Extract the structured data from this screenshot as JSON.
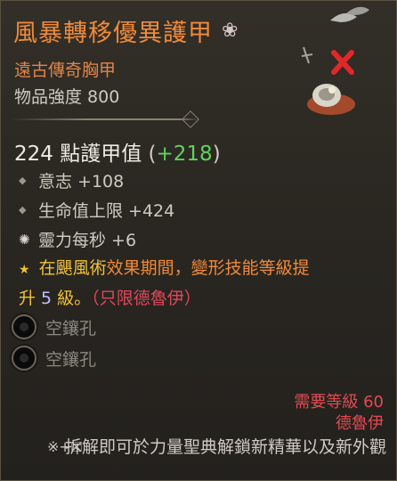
{
  "item": {
    "name": "風暴轉移優異護甲",
    "type": "遠古傳奇胸甲",
    "item_power": "物品強度 800"
  },
  "armor": {
    "base": "224 點護甲值",
    "paren_open": "(",
    "bonus": "+218",
    "paren_close": ")"
  },
  "stats": [
    {
      "label": "意志 +108"
    },
    {
      "label": "生命值上限 +424"
    },
    {
      "label": "靈力每秒 +6"
    }
  ],
  "effect": {
    "part1": "在颶風術",
    "part2": "效果期間，變形",
    "part3": "技能等級提",
    "part4": "升 ",
    "level": "5",
    "part5": " 級。",
    "restriction": "（只限德魯伊）"
  },
  "sockets": [
    {
      "label": "空鑲孔"
    },
    {
      "label": "空鑲孔"
    }
  ],
  "requirements": {
    "level": "需要等級 60",
    "class": "德魯伊"
  },
  "footer": {
    "symbol": "※+⛝",
    "text": "拆解即可於力量聖典解鎖新精華以及新外觀"
  },
  "colors": {
    "name": "#f08a3a",
    "bonus_green": "#5fd35a",
    "effect_yellow": "#f1c23a",
    "requirement_red": "#e24b52"
  }
}
